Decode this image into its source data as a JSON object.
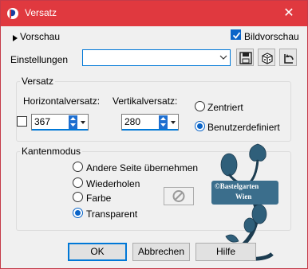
{
  "window": {
    "title": "Versatz",
    "close_glyph": "✕"
  },
  "top": {
    "preview_label": "Vorschau",
    "image_preview_label": "Bildvorschau",
    "image_preview_checked": true,
    "settings_label": "Einstellungen",
    "settings_value": ""
  },
  "offset": {
    "group_label": "Versatz",
    "horizontal_label": "Horizontalversatz:",
    "horizontal_value": "367",
    "vertical_label": "Vertikalversatz:",
    "vertical_value": "280",
    "centered_label": "Zentriert",
    "custom_label": "Benutzerdefiniert",
    "selected": "custom"
  },
  "edge_mode": {
    "group_label": "Kantenmodus",
    "options": [
      "Andere Seite übernehmen",
      "Wiederholen",
      "Farbe",
      "Transparent"
    ],
    "selected_index": 3
  },
  "watermark": {
    "line1": "©Bastelgarten",
    "line2": "Wien"
  },
  "buttons": {
    "ok": "OK",
    "cancel": "Abbrechen",
    "help": "Hilfe"
  },
  "colors": {
    "titlebar": "#e0393f",
    "accent": "#0078d7",
    "watermark": "#2f5f7a"
  }
}
